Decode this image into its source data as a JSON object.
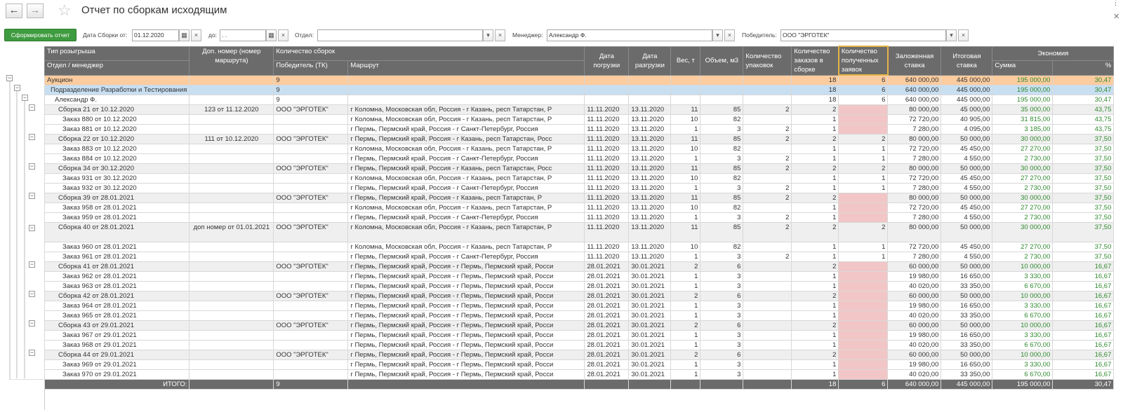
{
  "title": "Отчет по сборкам исходящим",
  "nav": {
    "back": "←",
    "forward": "→",
    "star": "☆"
  },
  "toolbar": {
    "generate_label": "Сформировать отчет",
    "date_from_label": "Дата Сборки от:",
    "date_from_value": "01.12.2020",
    "date_to_label": "до:",
    "date_to_value": " .  .",
    "dept_label": "Отдел:",
    "dept_value": "",
    "manager_label": "Менеджер:",
    "manager_value": "Александр Ф.",
    "winner_label": "Победитель:",
    "winner_value": "ООО \"ЭРГОТЕК\"",
    "cal": "▦",
    "clear": "×",
    "drop": "▾"
  },
  "headers": {
    "type": "Тип розыгрыша",
    "dept": "Отдел / менеджер",
    "extra": "Доп. номер (номер маршрута)",
    "count": "Количество сборок",
    "winner": "Победитель (ТК)",
    "route": "Маршрут",
    "load": "Дата погрузки",
    "unload": "Дата разгрузки",
    "weight": "Вес, т",
    "volume": "Объем, м3",
    "packs": "Количество упаковок",
    "orders": "Количество заказов в сборке",
    "bids": "Количество полученных заявок",
    "rate": "Заложенная ставка",
    "final": "Итоговая ставка",
    "economy": "Экономия",
    "sum": "Сумма",
    "pct": "%"
  },
  "rows": [
    {
      "k": "auction",
      "c": [
        "Аукцион",
        "",
        "9",
        "",
        "",
        "",
        "",
        "",
        "",
        "18",
        "6",
        "640 000,00",
        "445 000,00",
        "195 000,00",
        "30,47"
      ]
    },
    {
      "k": "dept",
      "c": [
        "Подразделение Разработки и Тестирования",
        "",
        "9",
        "",
        "",
        "",
        "",
        "",
        "",
        "18",
        "6",
        "640 000,00",
        "445 000,00",
        "195 000,00",
        "30,47"
      ]
    },
    {
      "k": "mgr",
      "c": [
        "Александр Ф.",
        "",
        "9",
        "",
        "",
        "",
        "",
        "",
        "",
        "18",
        "6",
        "640 000,00",
        "445 000,00",
        "195 000,00",
        "30,47"
      ]
    },
    {
      "k": "asm",
      "c": [
        "Сборка  21 от 10.12.2020",
        "123 от 11.12.2020",
        "ООО \"ЭРГОТЕК\"",
        "г Коломна,  Московская обл, Россия - г Казань,  респ Татарстан, Р",
        "11.11.2020",
        "13.11.2020",
        "11",
        "85",
        "2",
        "2",
        "",
        "80 000,00",
        "45 000,00",
        "35 000,00",
        "43,75"
      ],
      "p": 1
    },
    {
      "k": "ord",
      "c": [
        "Заказ 880 от 10.12.2020",
        "",
        "",
        "г Коломна,  Московская обл, Россия - г Казань,  респ Татарстан, Р",
        "11.11.2020",
        "13.11.2020",
        "10",
        "82",
        "",
        "1",
        "",
        "72 720,00",
        "40 905,00",
        "31 815,00",
        "43,75"
      ],
      "p": 1
    },
    {
      "k": "ord",
      "c": [
        "Заказ 881 от 10.12.2020",
        "",
        "",
        "г Пермь,  Пермский край, Россия - г Санкт-Петербург, Россия",
        "11.11.2020",
        "13.11.2020",
        "1",
        "3",
        "2",
        "1",
        "",
        "7 280,00",
        "4 095,00",
        "3 185,00",
        "43,75"
      ],
      "p": 1
    },
    {
      "k": "asm",
      "c": [
        "Сборка  22 от 10.12.2020",
        "111 от 10.12.2020",
        "ООО \"ЭРГОТЕК\"",
        "г Пермь,  Пермский край, Россия - г Казань,  респ Татарстан, Росс",
        "11.11.2020",
        "13.11.2020",
        "11",
        "85",
        "2",
        "2",
        "2",
        "80 000,00",
        "50 000,00",
        "30 000,00",
        "37,50"
      ]
    },
    {
      "k": "ord",
      "c": [
        "Заказ 883 от 10.12.2020",
        "",
        "",
        "г Коломна,  Московская обл, Россия - г Казань,  респ Татарстан, Р",
        "11.11.2020",
        "13.11.2020",
        "10",
        "82",
        "",
        "1",
        "1",
        "72 720,00",
        "45 450,00",
        "27 270,00",
        "37,50"
      ]
    },
    {
      "k": "ord",
      "c": [
        "Заказ 884 от 10.12.2020",
        "",
        "",
        "г Пермь,  Пермский край, Россия - г Санкт-Петербург, Россия",
        "11.11.2020",
        "13.11.2020",
        "1",
        "3",
        "2",
        "1",
        "1",
        "7 280,00",
        "4 550,00",
        "2 730,00",
        "37,50"
      ]
    },
    {
      "k": "asm",
      "c": [
        "Сборка  34 от 30.12.2020",
        "",
        "ООО \"ЭРГОТЕК\"",
        "г Пермь,  Пермский край, Россия - г Казань,  респ Татарстан, Росс",
        "11.11.2020",
        "13.11.2020",
        "11",
        "85",
        "2",
        "2",
        "2",
        "80 000,00",
        "50 000,00",
        "30 000,00",
        "37,50"
      ]
    },
    {
      "k": "ord",
      "c": [
        "Заказ 931 от 30.12.2020",
        "",
        "",
        "г Коломна,  Московская обл, Россия - г Казань,  респ Татарстан, Р",
        "11.11.2020",
        "13.11.2020",
        "10",
        "82",
        "",
        "1",
        "1",
        "72 720,00",
        "45 450,00",
        "27 270,00",
        "37,50"
      ]
    },
    {
      "k": "ord",
      "c": [
        "Заказ 932 от 30.12.2020",
        "",
        "",
        "г Пермь,  Пермский край, Россия - г Санкт-Петербург, Россия",
        "11.11.2020",
        "13.11.2020",
        "1",
        "3",
        "2",
        "1",
        "1",
        "7 280,00",
        "4 550,00",
        "2 730,00",
        "37,50"
      ]
    },
    {
      "k": "asm",
      "c": [
        "Сборка  39 от 28.01.2021",
        "",
        "ООО \"ЭРГОТЕК\"",
        "г Пермь,  Пермский край, Россия - г Казань,  респ Татарстан, Р",
        "11.11.2020",
        "13.11.2020",
        "11",
        "85",
        "2",
        "2",
        "",
        "80 000,00",
        "50 000,00",
        "30 000,00",
        "37,50"
      ],
      "p": 1
    },
    {
      "k": "ord",
      "c": [
        "Заказ 958 от 28.01.2021",
        "",
        "",
        "г Коломна,  Московская обл, Россия - г Казань,  респ Татарстан, Р",
        "11.11.2020",
        "13.11.2020",
        "10",
        "82",
        "",
        "1",
        "",
        "72 720,00",
        "45 450,00",
        "27 270,00",
        "37,50"
      ],
      "p": 1
    },
    {
      "k": "ord",
      "c": [
        "Заказ 959 от 28.01.2021",
        "",
        "",
        "г Пермь,  Пермский край, Россия - г Санкт-Петербург, Россия",
        "11.11.2020",
        "13.11.2020",
        "1",
        "3",
        "2",
        "1",
        "",
        "7 280,00",
        "4 550,00",
        "2 730,00",
        "37,50"
      ],
      "p": 1
    },
    {
      "k": "asm2",
      "c": [
        "Сборка  40 от 28.01.2021",
        "доп номер от 01.01.2021",
        "ООО \"ЭРГОТЕК\"",
        "г Коломна,  Московская обл, Россия - г Казань,  респ Татарстан, Р",
        "11.11.2020",
        "13.11.2020",
        "11",
        "85",
        "2",
        "2",
        "2",
        "80 000,00",
        "50 000,00",
        "30 000,00",
        "37,50"
      ]
    },
    {
      "k": "ord",
      "c": [
        "Заказ 960 от 28.01.2021",
        "",
        "",
        "г Коломна,  Московская обл, Россия - г Казань,  респ Татарстан, Р",
        "11.11.2020",
        "13.11.2020",
        "10",
        "82",
        "",
        "1",
        "1",
        "72 720,00",
        "45 450,00",
        "27 270,00",
        "37,50"
      ]
    },
    {
      "k": "ord",
      "c": [
        "Заказ 961 от 28.01.2021",
        "",
        "",
        "г Пермь,  Пермский край, Россия - г Санкт-Петербург, Россия",
        "11.11.2020",
        "13.11.2020",
        "1",
        "3",
        "2",
        "1",
        "1",
        "7 280,00",
        "4 550,00",
        "2 730,00",
        "37,50"
      ]
    },
    {
      "k": "asm",
      "c": [
        "Сборка  41 от 28.01.2021",
        "",
        "ООО \"ЭРГОТЕК\"",
        "г Пермь,  Пермский край, Россия - г Пермь,  Пермский край, Росси",
        "28.01.2021",
        "30.01.2021",
        "2",
        "6",
        "",
        "2",
        "",
        "60 000,00",
        "50 000,00",
        "10 000,00",
        "16,67"
      ],
      "p": 1
    },
    {
      "k": "ord",
      "c": [
        "Заказ 962 от 28.01.2021",
        "",
        "",
        "г Пермь,  Пермский край, Россия - г Пермь,  Пермский край, Росси",
        "28.01.2021",
        "30.01.2021",
        "1",
        "3",
        "",
        "1",
        "",
        "19 980,00",
        "16 650,00",
        "3 330,00",
        "16,67"
      ],
      "p": 1
    },
    {
      "k": "ord",
      "c": [
        "Заказ 963 от 28.01.2021",
        "",
        "",
        "г Пермь,  Пермский край, Россия - г Пермь,  Пермский край, Росси",
        "28.01.2021",
        "30.01.2021",
        "1",
        "3",
        "",
        "1",
        "",
        "40 020,00",
        "33 350,00",
        "6 670,00",
        "16,67"
      ],
      "p": 1
    },
    {
      "k": "asm",
      "c": [
        "Сборка  42 от 28.01.2021",
        "",
        "ООО \"ЭРГОТЕК\"",
        "г Пермь,  Пермский край, Россия - г Пермь,  Пермский край, Росси",
        "28.01.2021",
        "30.01.2021",
        "2",
        "6",
        "",
        "2",
        "",
        "60 000,00",
        "50 000,00",
        "10 000,00",
        "16,67"
      ],
      "p": 1
    },
    {
      "k": "ord",
      "c": [
        "Заказ 964 от 28.01.2021",
        "",
        "",
        "г Пермь,  Пермский край, Россия - г Пермь,  Пермский край, Росси",
        "28.01.2021",
        "30.01.2021",
        "1",
        "3",
        "",
        "1",
        "",
        "19 980,00",
        "16 650,00",
        "3 330,00",
        "16,67"
      ],
      "p": 1
    },
    {
      "k": "ord",
      "c": [
        "Заказ 965 от 28.01.2021",
        "",
        "",
        "г Пермь,  Пермский край, Россия - г Пермь,  Пермский край, Росси",
        "28.01.2021",
        "30.01.2021",
        "1",
        "3",
        "",
        "1",
        "",
        "40 020,00",
        "33 350,00",
        "6 670,00",
        "16,67"
      ],
      "p": 1
    },
    {
      "k": "asm",
      "c": [
        "Сборка  43 от 29.01.2021",
        "",
        "ООО \"ЭРГОТЕК\"",
        "г Пермь,  Пермский край, Россия - г Пермь,  Пермский край, Росси",
        "28.01.2021",
        "30.01.2021",
        "2",
        "6",
        "",
        "2",
        "",
        "60 000,00",
        "50 000,00",
        "10 000,00",
        "16,67"
      ],
      "p": 1
    },
    {
      "k": "ord",
      "c": [
        "Заказ 967 от 29.01.2021",
        "",
        "",
        "г Пермь,  Пермский край, Россия - г Пермь,  Пермский край, Росси",
        "28.01.2021",
        "30.01.2021",
        "1",
        "3",
        "",
        "1",
        "",
        "19 980,00",
        "16 650,00",
        "3 330,00",
        "16,67"
      ],
      "p": 1
    },
    {
      "k": "ord",
      "c": [
        "Заказ 968 от 29.01.2021",
        "",
        "",
        "г Пермь,  Пермский край, Россия - г Пермь,  Пермский край, Росси",
        "28.01.2021",
        "30.01.2021",
        "1",
        "3",
        "",
        "1",
        "",
        "40 020,00",
        "33 350,00",
        "6 670,00",
        "16,67"
      ],
      "p": 1
    },
    {
      "k": "asm",
      "c": [
        "Сборка  44 от 29.01.2021",
        "",
        "ООО \"ЭРГОТЕК\"",
        "г Пермь,  Пермский край, Россия - г Пермь,  Пермский край, Росси",
        "28.01.2021",
        "30.01.2021",
        "2",
        "6",
        "",
        "2",
        "",
        "60 000,00",
        "50 000,00",
        "10 000,00",
        "16,67"
      ],
      "p": 1
    },
    {
      "k": "ord",
      "c": [
        "Заказ 969 от 29.01.2021",
        "",
        "",
        "г Пермь,  Пермский край, Россия - г Пермь,  Пермский край, Росси",
        "28.01.2021",
        "30.01.2021",
        "1",
        "3",
        "",
        "1",
        "",
        "19 980,00",
        "16 650,00",
        "3 330,00",
        "16,67"
      ],
      "p": 1
    },
    {
      "k": "ord",
      "c": [
        "Заказ 970 от 29.01.2021",
        "",
        "",
        "г Пермь,  Пермский край, Россия - г Пермь,  Пермский край, Росси",
        "28.01.2021",
        "30.01.2021",
        "1",
        "3",
        "",
        "1",
        "",
        "40 020,00",
        "33 350,00",
        "6 670,00",
        "16,67"
      ],
      "p": 1
    }
  ],
  "total": {
    "label": "ИТОГО:",
    "count": "9",
    "orders": "18",
    "bids": "6",
    "rate": "640 000,00",
    "final": "445 000,00",
    "sum": "195 000,00",
    "pct": "30,47"
  },
  "colors": {
    "accent": "#3f9b3f",
    "auction": "#fbcc9f",
    "dept": "#c8dff1",
    "pending": "#f2c6c6",
    "economy": "#2f8a2f"
  }
}
